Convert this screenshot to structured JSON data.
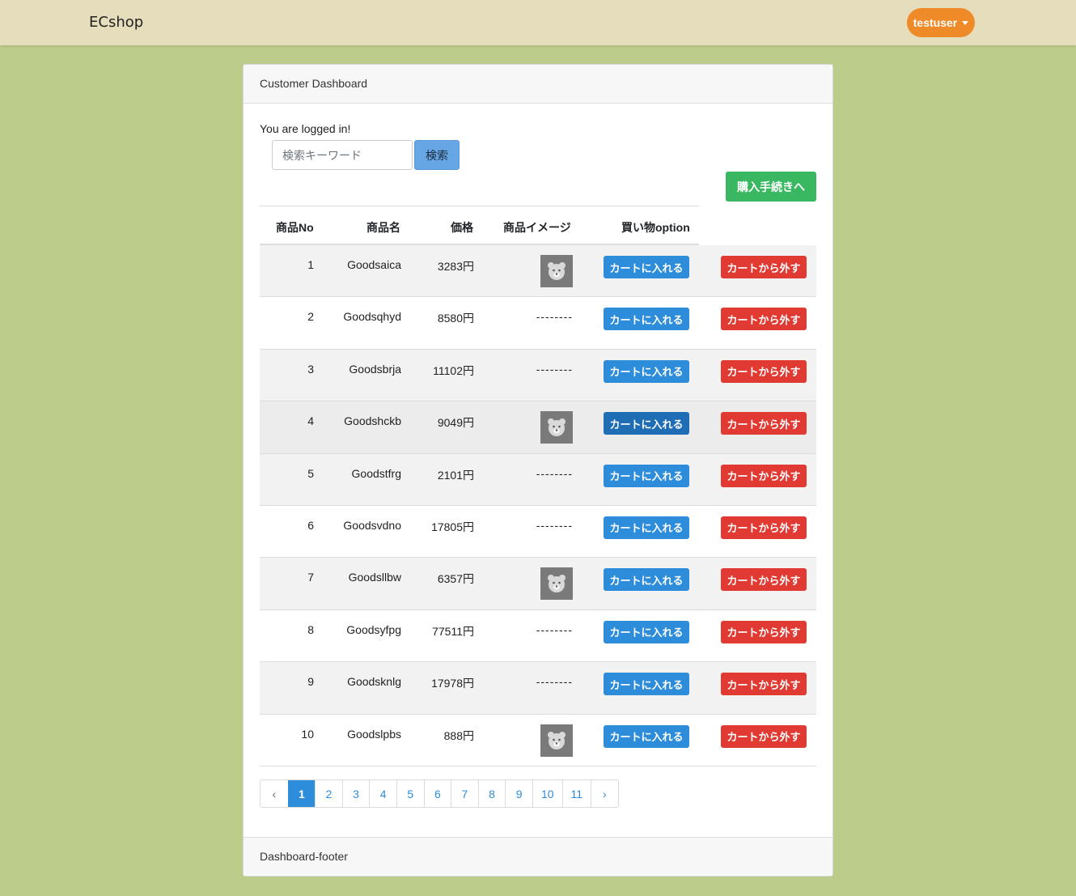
{
  "navbar": {
    "brand": "ECshop",
    "user": "testuser"
  },
  "card": {
    "header": "Customer Dashboard",
    "status": "You are logged in!",
    "footer": "Dashboard-footer"
  },
  "search": {
    "placeholder": "検索キーワード",
    "button": "検索"
  },
  "checkout_button": "購入手続きへ",
  "table": {
    "headers": [
      "商品No",
      "商品名",
      "価格",
      "商品イメージ",
      "買い物option"
    ],
    "no_image": "--------",
    "add_label": "カートに入れる",
    "remove_label": "カートから外す",
    "rows": [
      {
        "no": "1",
        "name": "Goodsaica",
        "price": "3283円",
        "image": "bear-thumbnail"
      },
      {
        "no": "2",
        "name": "Goodsqhyd",
        "price": "8580円",
        "image": null
      },
      {
        "no": "3",
        "name": "Goodsbrja",
        "price": "11102円",
        "image": null
      },
      {
        "no": "4",
        "name": "Goodshckb",
        "price": "9049円",
        "image": "bear-thumbnail"
      },
      {
        "no": "5",
        "name": "Goodstfrg",
        "price": "2101円",
        "image": null
      },
      {
        "no": "6",
        "name": "Goodsvdno",
        "price": "17805円",
        "image": null
      },
      {
        "no": "7",
        "name": "Goodsllbw",
        "price": "6357円",
        "image": "bear-thumbnail"
      },
      {
        "no": "8",
        "name": "Goodsyfpg",
        "price": "77511円",
        "image": null
      },
      {
        "no": "9",
        "name": "Goodsknlg",
        "price": "17978円",
        "image": null
      },
      {
        "no": "10",
        "name": "Goodslpbs",
        "price": "888円",
        "image": "bear-thumbnail"
      }
    ]
  },
  "pagination": {
    "prev": "‹",
    "next": "›",
    "pages": [
      "1",
      "2",
      "3",
      "4",
      "5",
      "6",
      "7",
      "8",
      "9",
      "10",
      "11"
    ],
    "current": "1"
  },
  "colors": {
    "background": "#bccc8a",
    "navbar": "#e5ddbb",
    "user_button": "#ee8a27",
    "primary": "#2d8ddb",
    "danger": "#e03a32",
    "success": "#39b861"
  }
}
